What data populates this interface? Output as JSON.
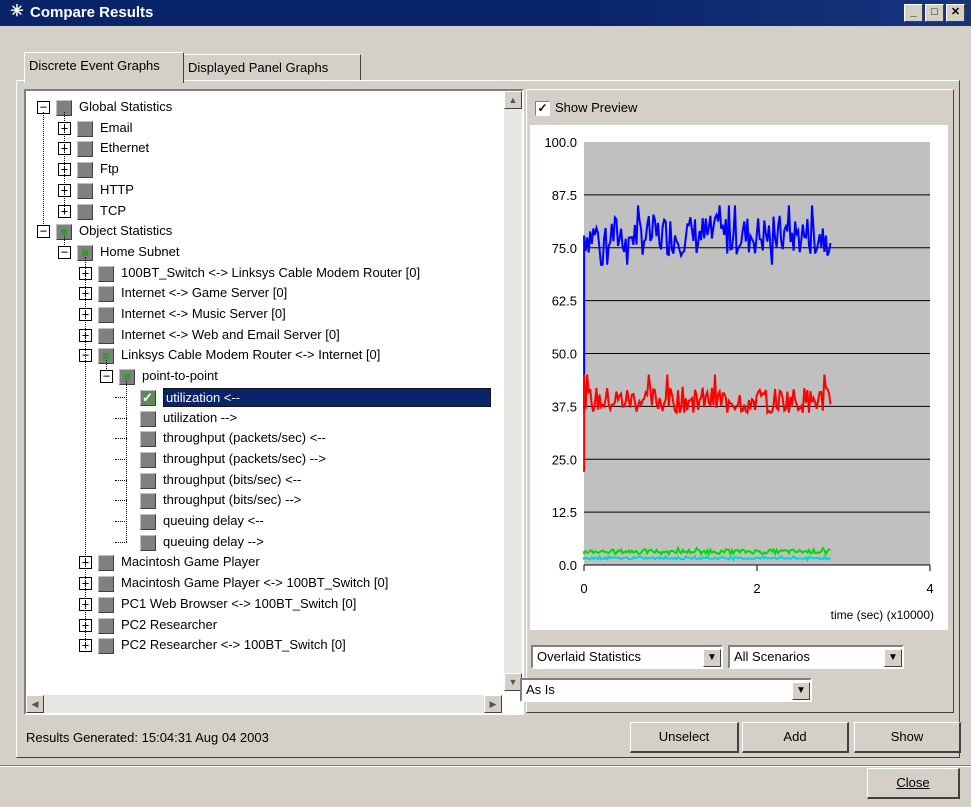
{
  "window": {
    "title": "Compare Results",
    "title_icon": "star-burst-icon"
  },
  "tabs": [
    {
      "label": "Discrete Event Graphs"
    },
    {
      "label": "Displayed Panel Graphs"
    }
  ],
  "tree": [
    {
      "label": "Global Statistics",
      "level": 0,
      "expander": "−",
      "marker": "gray"
    },
    {
      "label": "Email",
      "level": 1,
      "expander": "+",
      "marker": "gray"
    },
    {
      "label": "Ethernet",
      "level": 1,
      "expander": "+",
      "marker": "gray"
    },
    {
      "label": "Ftp",
      "level": 1,
      "expander": "+",
      "marker": "gray"
    },
    {
      "label": "HTTP",
      "level": 1,
      "expander": "+",
      "marker": "gray"
    },
    {
      "label": "TCP",
      "level": 1,
      "expander": "+",
      "marker": "gray"
    },
    {
      "label": "Object Statistics",
      "level": 0,
      "expander": "−",
      "marker": "green"
    },
    {
      "label": "Home Subnet",
      "level": 1,
      "expander": "−",
      "marker": "green"
    },
    {
      "label": "100BT_Switch <-> Linksys Cable Modem Router [0]",
      "level": 2,
      "expander": "+",
      "marker": "gray"
    },
    {
      "label": "Internet <-> Game Server [0]",
      "level": 2,
      "expander": "+",
      "marker": "gray"
    },
    {
      "label": "Internet <-> Music Server [0]",
      "level": 2,
      "expander": "+",
      "marker": "gray"
    },
    {
      "label": "Internet <-> Web and Email Server [0]",
      "level": 2,
      "expander": "+",
      "marker": "gray"
    },
    {
      "label": "Linksys Cable Modem Router <-> Internet [0]",
      "level": 2,
      "expander": "−",
      "marker": "green"
    },
    {
      "label": "point-to-point",
      "level": 3,
      "expander": "−",
      "marker": "green"
    },
    {
      "label": "utilization <--",
      "level": 4,
      "expander": "",
      "marker": "checked",
      "selected": true
    },
    {
      "label": "utilization -->",
      "level": 4,
      "expander": "",
      "marker": "gray"
    },
    {
      "label": "throughput (packets/sec) <--",
      "level": 4,
      "expander": "",
      "marker": "gray"
    },
    {
      "label": "throughput (packets/sec) -->",
      "level": 4,
      "expander": "",
      "marker": "gray"
    },
    {
      "label": "throughput (bits/sec) <--",
      "level": 4,
      "expander": "",
      "marker": "gray"
    },
    {
      "label": "throughput (bits/sec) -->",
      "level": 4,
      "expander": "",
      "marker": "gray"
    },
    {
      "label": "queuing delay <--",
      "level": 4,
      "expander": "",
      "marker": "gray"
    },
    {
      "label": "queuing delay -->",
      "level": 4,
      "expander": "",
      "marker": "gray"
    },
    {
      "label": "Macintosh Game Player",
      "level": 2,
      "expander": "+",
      "marker": "gray"
    },
    {
      "label": "Macintosh Game Player <-> 100BT_Switch [0]",
      "level": 2,
      "expander": "+",
      "marker": "gray"
    },
    {
      "label": "PC1 Web Browser <-> 100BT_Switch [0]",
      "level": 2,
      "expander": "+",
      "marker": "gray"
    },
    {
      "label": "PC2 Researcher",
      "level": 2,
      "expander": "+",
      "marker": "gray"
    },
    {
      "label": "PC2 Researcher <-> 100BT_Switch [0]",
      "level": 2,
      "expander": "+",
      "marker": "gray"
    }
  ],
  "preview": {
    "show_preview_label": "Show Preview",
    "checked": true
  },
  "controls": {
    "overlay_select": "Overlaid Statistics",
    "scenarios_select": "All Scenarios",
    "mode_select": "As Is"
  },
  "status": {
    "text": "Results Generated: 15:04:31 Aug 04 2003"
  },
  "buttons": {
    "unselect": "Unselect",
    "add": "Add",
    "show": "Show",
    "close": "Close"
  },
  "chart_data": {
    "type": "line",
    "xlabel": "time (sec) (x10000)",
    "xlim": [
      0,
      4
    ],
    "ylim": [
      0,
      100
    ],
    "x_ticks": [
      "0",
      "2",
      "4"
    ],
    "y_ticks": [
      "100.0",
      "87.5",
      "75.0",
      "62.5",
      "50.0",
      "37.5",
      "25.0",
      "12.5",
      "0.0"
    ],
    "grid": true,
    "series": [
      {
        "color": "#0000ff",
        "x_start": 0,
        "x_end": 2.85,
        "start_value": 36,
        "mean": 78,
        "min": 71,
        "max": 85
      },
      {
        "color": "#ff0000",
        "x_start": 0,
        "x_end": 2.85,
        "start_value": 22,
        "mean": 39,
        "min": 36,
        "max": 45
      },
      {
        "color": "#00dd00",
        "x_start": 0,
        "x_end": 2.85,
        "start_value": 2.5,
        "mean": 3.2,
        "min": 2.6,
        "max": 4
      },
      {
        "color": "#00d8d8",
        "x_start": 0,
        "x_end": 2.85,
        "start_value": 1.2,
        "mean": 1.6,
        "min": 1.2,
        "max": 2
      }
    ]
  }
}
